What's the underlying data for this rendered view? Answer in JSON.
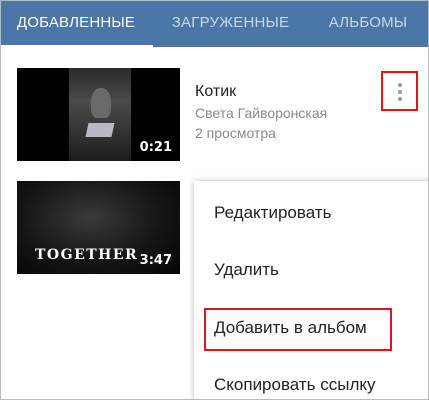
{
  "tabs": [
    {
      "label": "ДОБАВЛЕННЫЕ",
      "active": true
    },
    {
      "label": "ЗАГРУЖЕННЫЕ",
      "active": false
    },
    {
      "label": "АЛЬБОМЫ",
      "active": false
    }
  ],
  "videos": [
    {
      "title": "Котик",
      "author": "Света Гайворонская",
      "views": "2 просмотра",
      "duration": "0:21"
    },
    {
      "overlay_text": "TOGETHER",
      "duration": "3:47"
    }
  ],
  "menu": {
    "items": [
      {
        "label": "Редактировать"
      },
      {
        "label": "Удалить"
      },
      {
        "label": "Добавить в альбом",
        "highlighted": true
      },
      {
        "label": "Скопировать ссылку"
      }
    ]
  },
  "colors": {
    "header": "#4a76a8",
    "highlight": "#e0141e"
  }
}
